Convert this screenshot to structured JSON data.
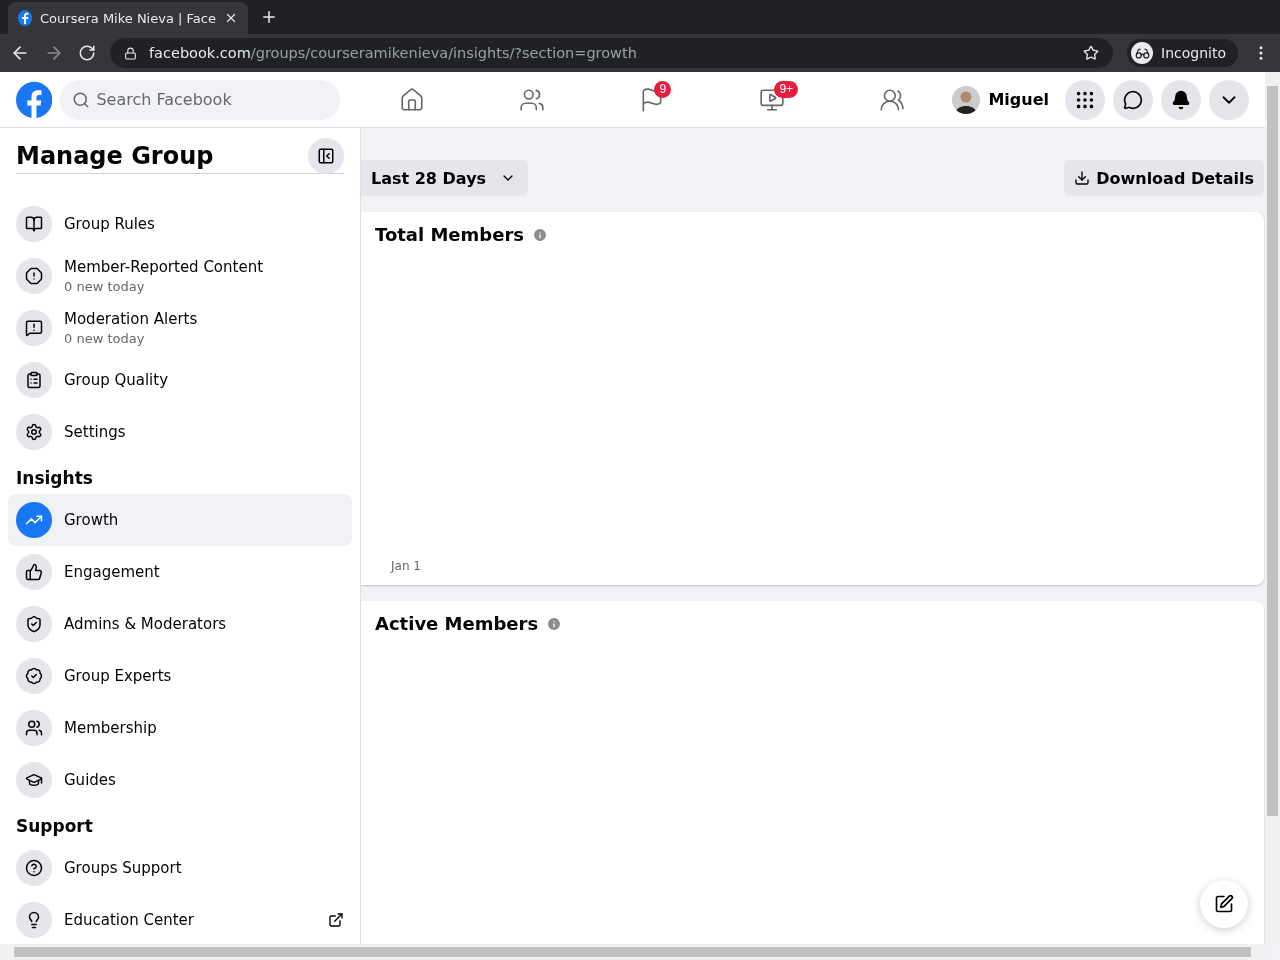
{
  "browser": {
    "tab_title": "Coursera Mike Nieva | Face",
    "url_host": "facebook.com",
    "url_path": "/groups/courseramikenieva/insights/?section=growth",
    "profile": "Incognito"
  },
  "header": {
    "search": {
      "placeholder": "Search Facebook"
    },
    "nav": [
      {
        "kind": "home",
        "selected": false
      },
      {
        "kind": "friends",
        "selected": false
      },
      {
        "kind": "pages",
        "badge": "9",
        "selected": false
      },
      {
        "kind": "watch",
        "badge": "9+",
        "selected": false
      },
      {
        "kind": "groups",
        "selected": false
      }
    ],
    "user": "Miguel"
  },
  "sidebar": {
    "title": "Manage Group",
    "sections": [
      {
        "items": [
          {
            "label": "Group Rules",
            "selected": false
          },
          {
            "label": "Member-Reported Content",
            "sub": "0 new today",
            "selected": false
          },
          {
            "label": "Moderation Alerts",
            "sub": "0 new today",
            "selected": false
          },
          {
            "label": "Group Quality",
            "selected": false
          },
          {
            "label": "Settings",
            "selected": false
          }
        ]
      },
      {
        "heading": "Insights",
        "items": [
          {
            "label": "Growth",
            "selected": true
          },
          {
            "label": "Engagement",
            "selected": false
          },
          {
            "label": "Admins & Moderators",
            "selected": false
          },
          {
            "label": "Group Experts",
            "selected": false
          },
          {
            "label": "Membership",
            "selected": false
          },
          {
            "label": "Guides",
            "selected": false
          }
        ]
      },
      {
        "heading": "Support",
        "items": [
          {
            "label": "Groups Support",
            "selected": false
          },
          {
            "label": "Education Center",
            "external": true,
            "selected": false
          }
        ]
      }
    ]
  },
  "main": {
    "range": "Last 28 Days",
    "download": "Download Details",
    "cards": [
      {
        "title": "Total Members",
        "axis_label": "Jan 1"
      },
      {
        "title": "Active Members"
      }
    ]
  }
}
